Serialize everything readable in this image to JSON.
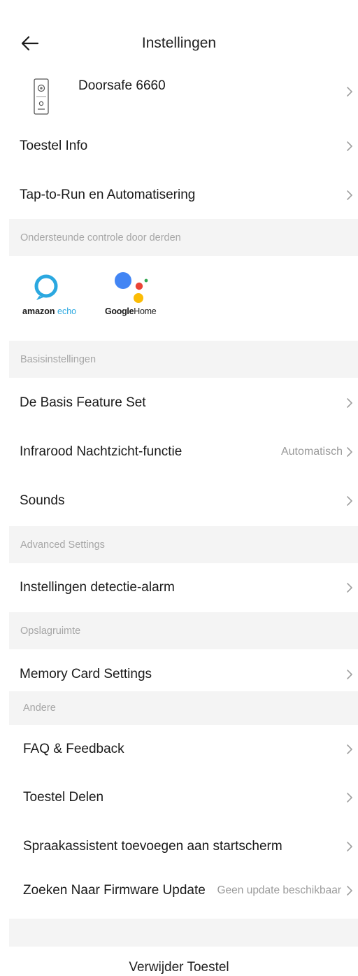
{
  "header": {
    "title": "Instellingen"
  },
  "device": {
    "name": "Doorsafe 6660"
  },
  "rows": {
    "toestel_info": "Toestel Info",
    "tap_to_run": "Tap-to-Run en Automatisering",
    "basis_feature": "De Basis Feature Set",
    "infrarood": "Infrarood Nachtzicht-functie",
    "infrarood_value": "Automatisch",
    "sounds": "Sounds",
    "detectie": "Instellingen detectie-alarm",
    "memory": "Memory Card Settings",
    "faq": "FAQ & Feedback",
    "delen": "Toestel Delen",
    "spraak": "Spraakassistent toevoegen aan startscherm",
    "firmware": "Zoeken Naar Firmware Update",
    "firmware_value": "Geen update beschikbaar"
  },
  "sections": {
    "third_party": "Ondersteunde controle door derden",
    "basis": "Basisinstellingen",
    "advanced": "Advanced Settings",
    "opslag": "Opslagruimte",
    "andere": "Andere"
  },
  "assistants": {
    "alexa_brand": "amazon",
    "alexa_product": "echo",
    "google_brand": "Google",
    "google_product": "Home"
  },
  "footer": {
    "remove": "Verwijder Toestel"
  },
  "icons": {
    "back": "arrow-left-icon",
    "chevron": "chevron-right-icon",
    "device": "doorbell-icon",
    "alexa": "alexa-ring-icon",
    "google": "google-assistant-icon"
  },
  "colors": {
    "section_bg": "#f4f4f4",
    "section_text": "#a6a6a6",
    "alexa_blue": "#2ba8e0",
    "google_blue": "#4285f4",
    "google_red": "#ea4335",
    "google_yellow": "#fbbc05",
    "google_green": "#34a853"
  }
}
